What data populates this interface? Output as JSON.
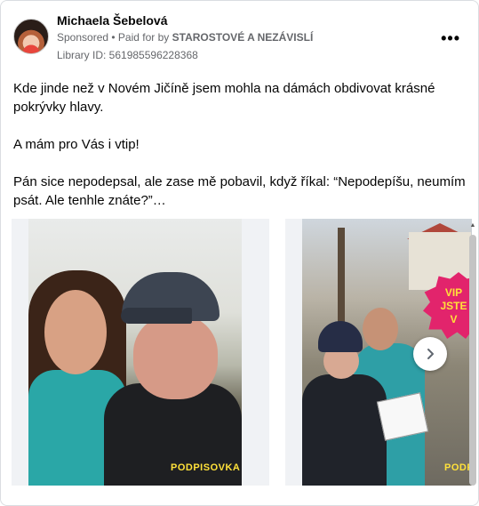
{
  "post": {
    "author": "Michaela Šebelová",
    "sponsored_label": "Sponsored",
    "separator": " • ",
    "paid_for_prefix": "Paid for by ",
    "paid_for_by": "STAROSTOVÉ A NEZÁVISLÍ",
    "library_id": "Library ID: 561985596228368",
    "more_options": "•••",
    "paragraphs": [
      "Kde jinde než v Novém Jičíně jsem mohla na dámách obdivovat krásné pokrývky hlavy.",
      "A mám pro Vás i vtip!",
      "Pán sice nepodepsal, ale zase mě pobavil, když říkal: “Nepodepíšu, neumím psát. Ale tenhle znáte?”…"
    ]
  },
  "carousel": {
    "slides": [
      {
        "overlay_text": "PODPISOVKA"
      },
      {
        "overlay_text": "PODPISOVKA",
        "badge_line1": "VIP",
        "badge_line2": "JSTE V"
      }
    ]
  },
  "icons": {
    "next": "chevron-right-icon",
    "more": "more-horizontal-icon",
    "scroll_up": "scroll-up-arrow-icon"
  },
  "colors": {
    "meta_text": "#65676b",
    "badge_pink": "#e2246c",
    "overlay_yellow": "#ffe13a"
  }
}
